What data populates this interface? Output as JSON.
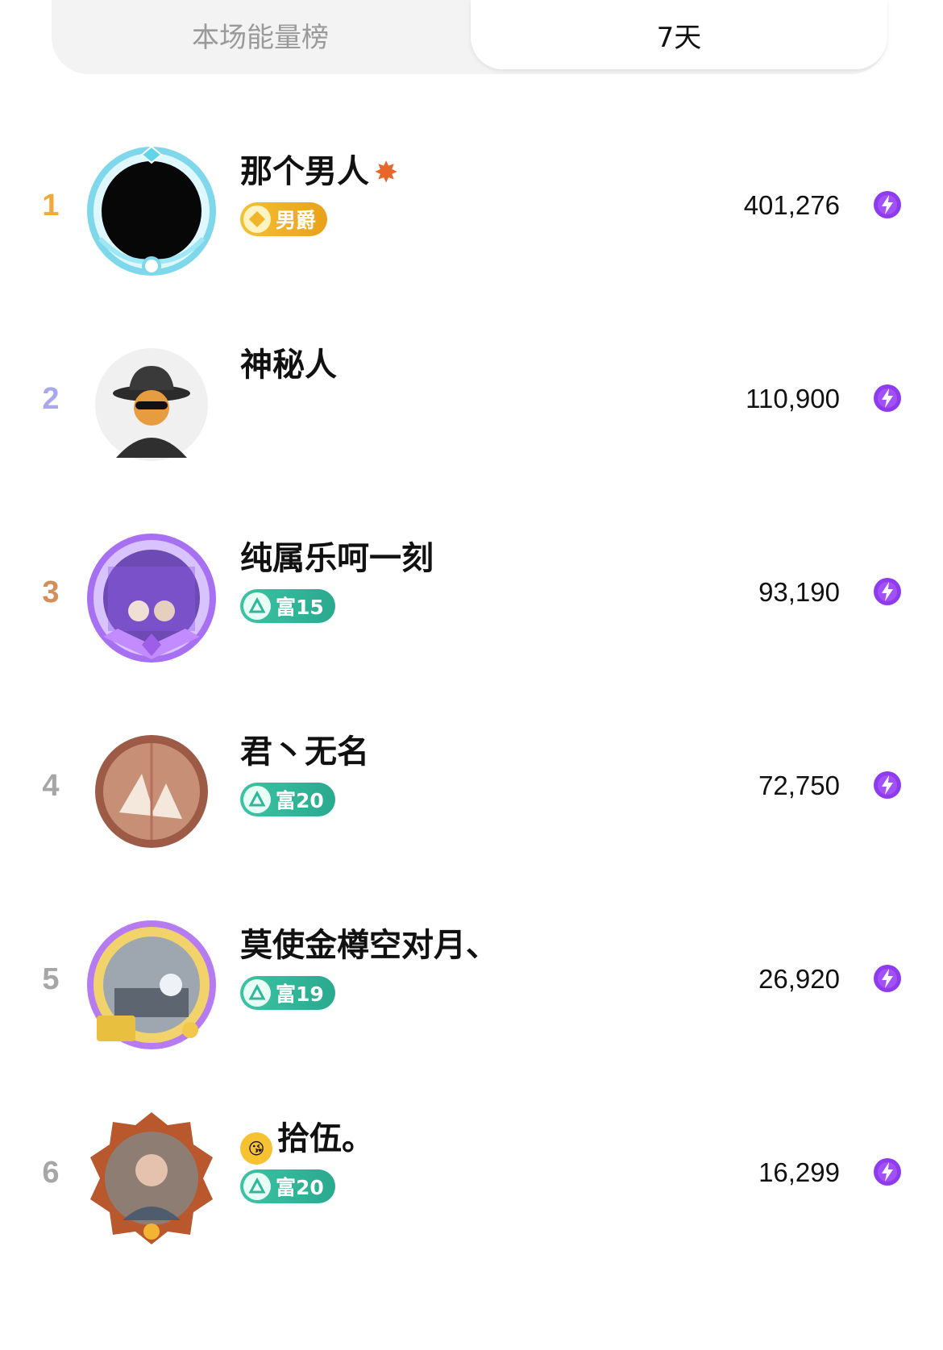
{
  "tabs": [
    {
      "label": "本场能量榜",
      "active": false
    },
    {
      "label": "7天",
      "active": true
    }
  ],
  "colors": {
    "rank_1": "#f2a93b",
    "rank_2": "#a9a8ee",
    "rank_3": "#d58e57",
    "rank_other": "#a6a6a6",
    "badge_gold": "#ecae22",
    "badge_green": "#33b59a",
    "bolt": "#8e3bf0"
  },
  "rows": [
    {
      "rank": "1",
      "name": "那个男人",
      "badge": "男爵",
      "score": "401,276"
    },
    {
      "rank": "2",
      "name": "神秘人",
      "badge": "",
      "score": "110,900"
    },
    {
      "rank": "3",
      "name": "纯属乐呵一刻",
      "badge": "富15",
      "score": "93,190"
    },
    {
      "rank": "4",
      "name": "君丶无名",
      "badge": "富20",
      "score": "72,750"
    },
    {
      "rank": "5",
      "name": "莫使金樽空对月、",
      "badge": "富19",
      "score": "26,920"
    },
    {
      "rank": "6",
      "name": "拾伍。",
      "badge": "富20",
      "score": "16,299"
    }
  ]
}
